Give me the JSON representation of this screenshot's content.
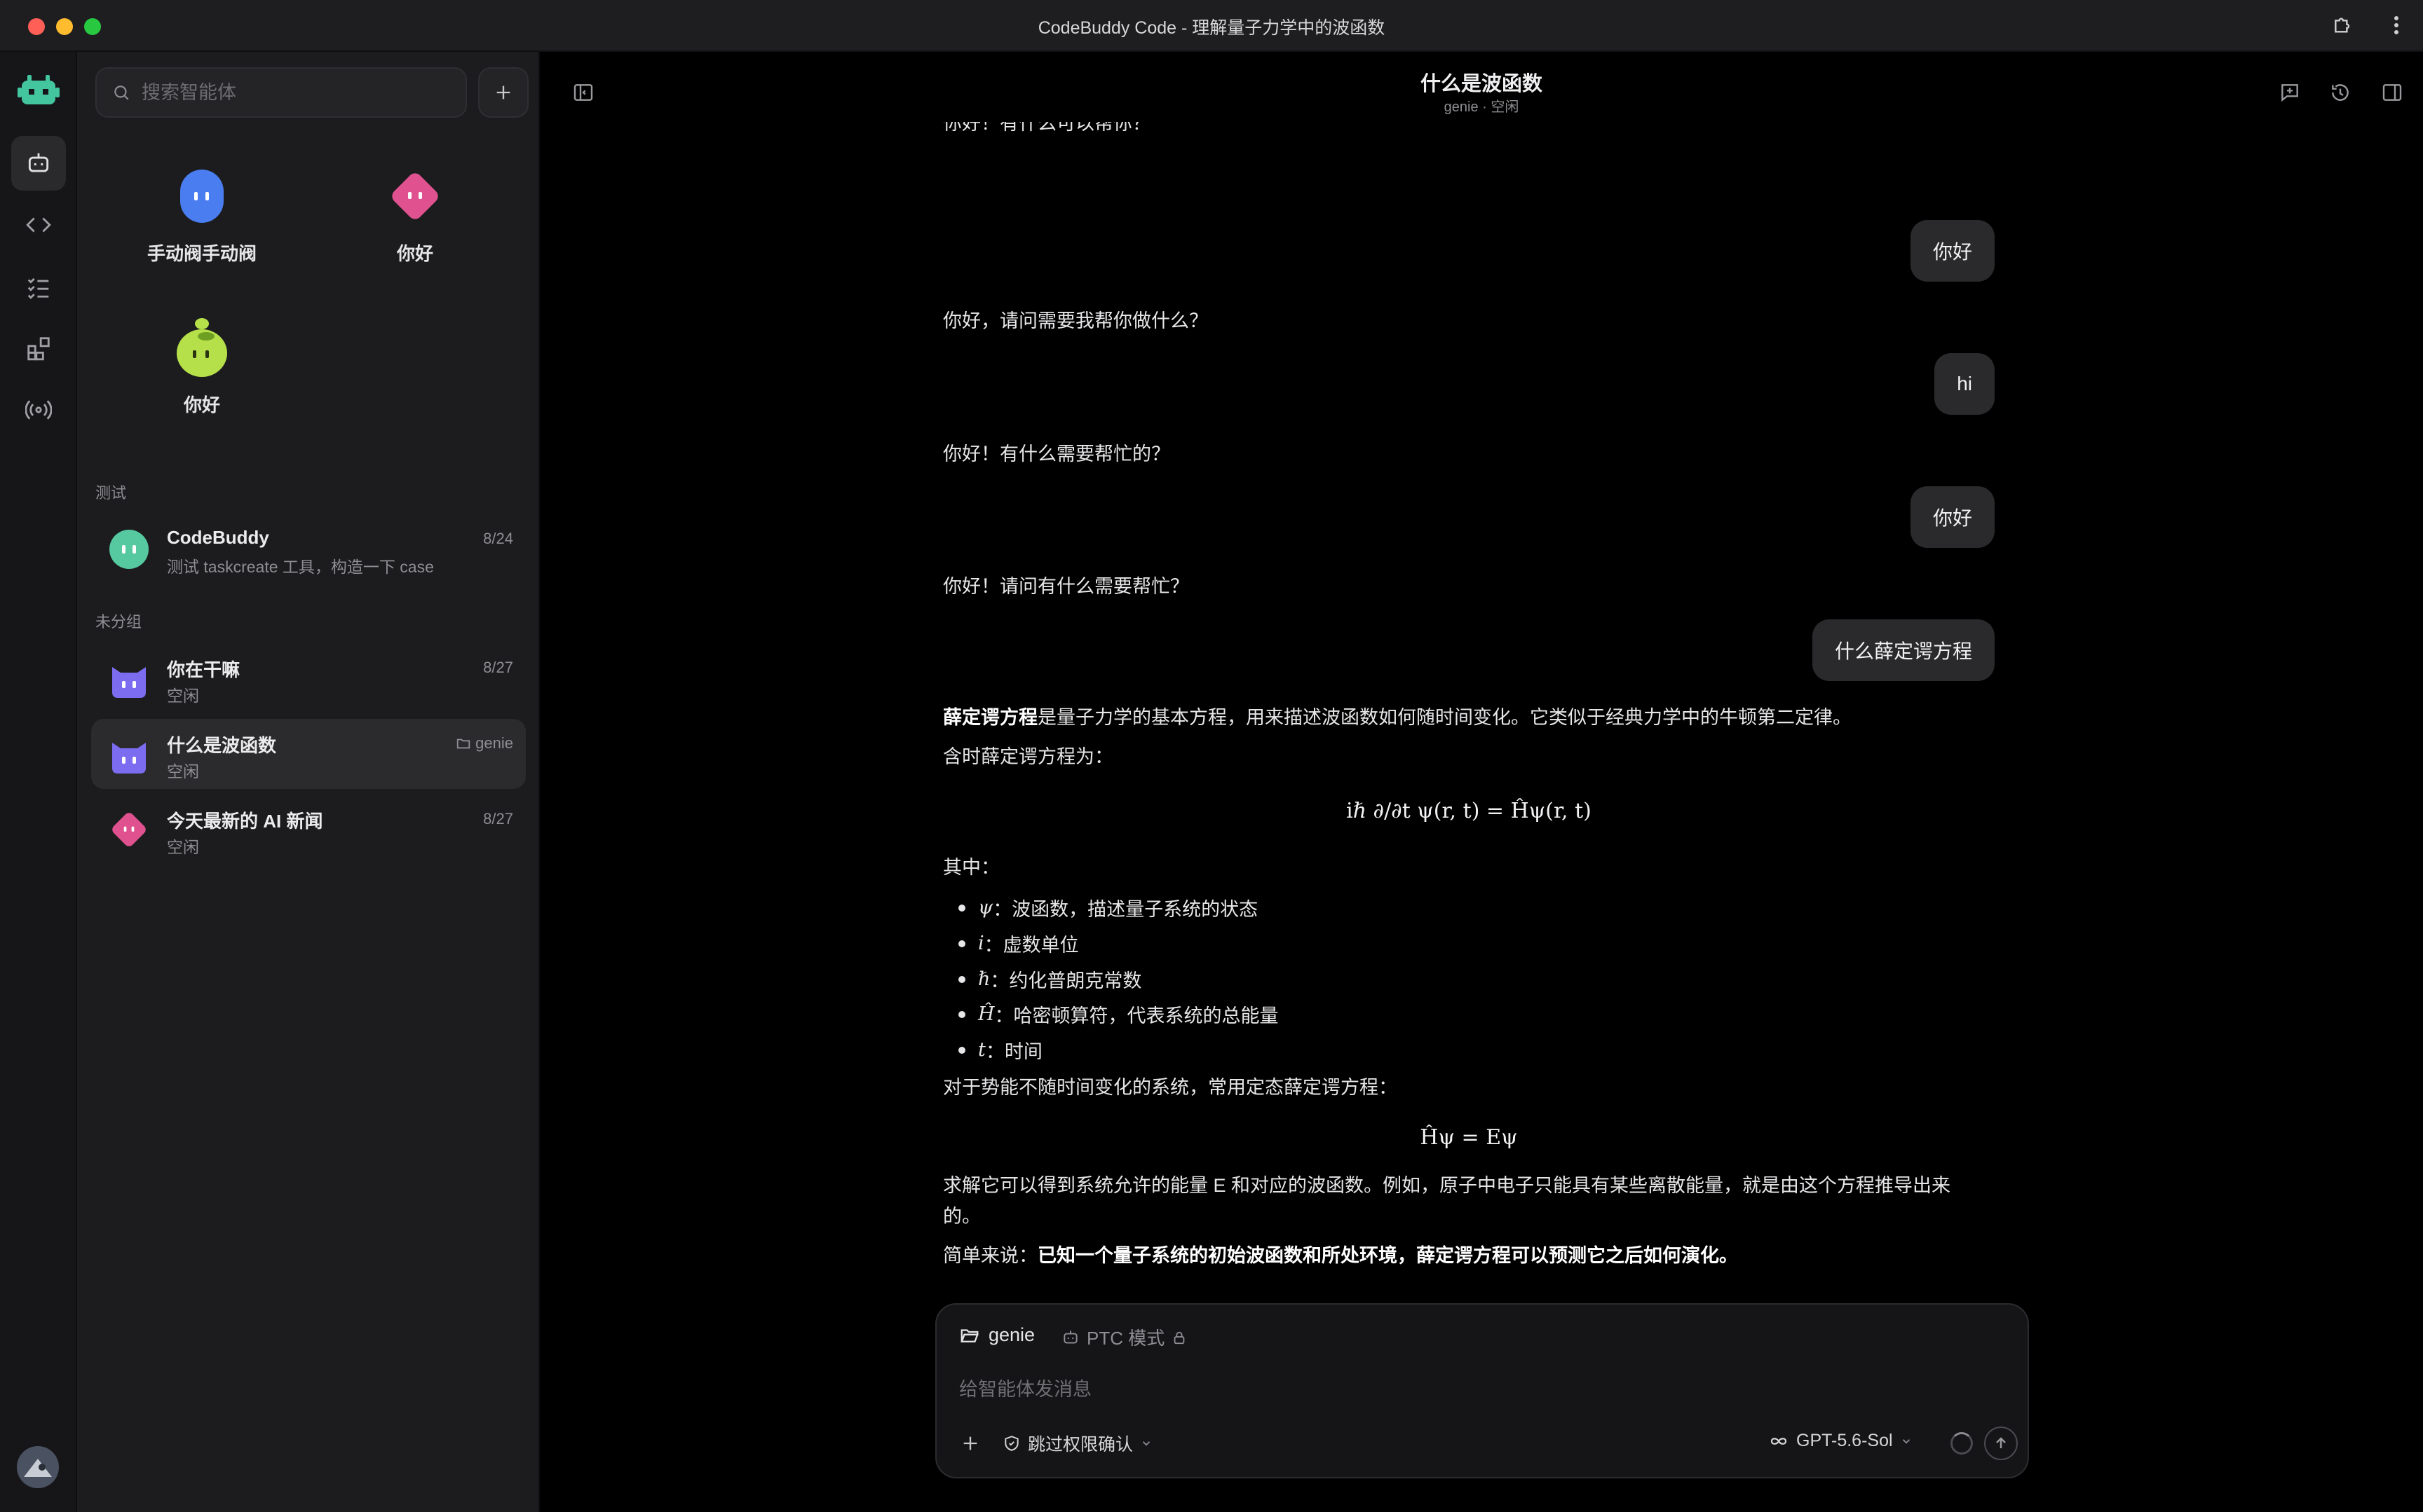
{
  "window": {
    "title": "CodeBuddy Code - 理解量子力学中的波函数"
  },
  "sidebar": {
    "search_placeholder": "搜索智能体",
    "agents": [
      {
        "label": "手动阀手动阀",
        "color": "#4a7ef0"
      },
      {
        "label": "你好",
        "color": "#e0528f"
      },
      {
        "label": "你好",
        "color": "#b6e04a"
      }
    ],
    "groups": [
      {
        "name": "测试",
        "conversations": [
          {
            "title": "CodeBuddy",
            "subtitle": "测试 taskcreate 工具，构造一下 case",
            "date": "8/24"
          }
        ]
      },
      {
        "name": "未分组",
        "conversations": [
          {
            "title": "你在干嘛",
            "subtitle": "空闲",
            "date": "8/27"
          },
          {
            "title": "什么是波函数",
            "subtitle": "空闲",
            "tag": "genie"
          },
          {
            "title": "今天最新的 AI 新闻",
            "subtitle": "空闲",
            "date": "8/27"
          }
        ]
      }
    ]
  },
  "header": {
    "title": "什么是波函数",
    "subtitle": "genie · 空闲"
  },
  "chat": {
    "partial_top": "你好！有什么可以帮你？",
    "turns": [
      {
        "user": "你好",
        "assistant": "你好，请问需要我帮你做什么？"
      },
      {
        "user": "hi",
        "assistant": "你好！有什么需要帮忙的？"
      },
      {
        "user": "你好",
        "assistant": "你好！请问有什么需要帮忙？"
      },
      {
        "user": "什么薛定谔方程"
      }
    ],
    "answer": {
      "intro_bold": "薛定谔方程",
      "intro_rest": "是量子力学的基本方程，用来描述波函数如何随时间变化。它类似于经典力学中的牛顿第二定律。",
      "time_dep": "含时薛定谔方程为：",
      "eq1": "iℏ ∂/∂t ψ(r, t) = Ĥψ(r, t)",
      "where": "其中：",
      "bullets": [
        {
          "sym": "ψ",
          "text": "：波函数，描述量子系统的状态"
        },
        {
          "sym": "i",
          "text": "：虚数单位"
        },
        {
          "sym": "ℏ",
          "text": "：约化普朗克常数"
        },
        {
          "sym": "Ĥ",
          "text": "：哈密顿算符，代表系统的总能量"
        },
        {
          "sym": "t",
          "text": "：时间"
        }
      ],
      "stationary": "对于势能不随时间变化的系统，常用定态薛定谔方程：",
      "eq2": "Ĥψ = Eψ",
      "solve_line1": "求解它可以得到系统允许的能量 E 和对应的波函数。例如，原子中电子只能具有某些离散能量，就是由这个方程推导出来",
      "solve_line2": "的。",
      "summary_prefix": "简单来说：",
      "summary_bold": "已知一个量子系统的初始波函数和所处环境，薛定谔方程可以预测它之后如何演化。"
    }
  },
  "composer": {
    "folder": "genie",
    "mode": "PTC 模式",
    "placeholder": "给智能体发消息",
    "permission": "跳过权限确认",
    "model": "GPT-5.6-Sol"
  }
}
